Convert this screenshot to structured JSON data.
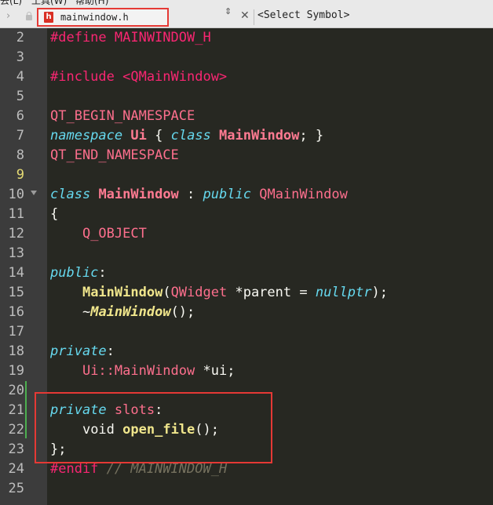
{
  "menubar": {
    "items": [
      "去(L)",
      "工具(W)",
      "帮助(H)"
    ]
  },
  "tab": {
    "file_name": "mainwindow.h",
    "file_icon_letter": "h",
    "symbol_placeholder": "<Select Symbol>",
    "updown_glyph": "⇕",
    "close_glyph": "✕",
    "nav_glyph": "›"
  },
  "gutter": {
    "current_line": 9,
    "lines": [
      "2",
      "3",
      "4",
      "5",
      "6",
      "7",
      "8",
      "9",
      "10",
      "11",
      "12",
      "13",
      "14",
      "15",
      "16",
      "17",
      "18",
      "19",
      "20",
      "21",
      "22",
      "23",
      "24",
      "25"
    ]
  },
  "colors": {
    "background": "#272822",
    "gutter": "#3c3c3c",
    "keyword": "#66d9ef",
    "type": "#ff7b92",
    "function": "#f0e68c",
    "highlight_box": "#e53935"
  },
  "code": {
    "l2": [
      "#define MAINWINDOW_H"
    ],
    "l4": [
      "#include <QMainWindow>"
    ],
    "l6": [
      "QT_BEGIN_NAMESPACE"
    ],
    "l7": [
      "namespace",
      "Ui",
      "{",
      "class",
      "MainWindow",
      "; }"
    ],
    "l8": [
      "QT_END_NAMESPACE"
    ],
    "l10": [
      "class",
      "MainWindow",
      ":",
      "public",
      "QMainWindow"
    ],
    "l11": [
      "{"
    ],
    "l12": [
      "Q_OBJECT"
    ],
    "l14": [
      "public",
      ":"
    ],
    "l15": [
      "MainWindow",
      "(",
      "QWidget",
      "*parent = ",
      "nullptr",
      ");"
    ],
    "l16": [
      "~",
      "MainWindow",
      "();"
    ],
    "l18": [
      "private",
      ":"
    ],
    "l19": [
      "Ui::MainWindow",
      "*ui;"
    ],
    "l21": [
      "private",
      "slots",
      ":"
    ],
    "l22": [
      "void",
      "open_file",
      "();"
    ],
    "l23": [
      "};"
    ],
    "l24": [
      "#endif",
      "// MAINWINDOW_H"
    ]
  }
}
